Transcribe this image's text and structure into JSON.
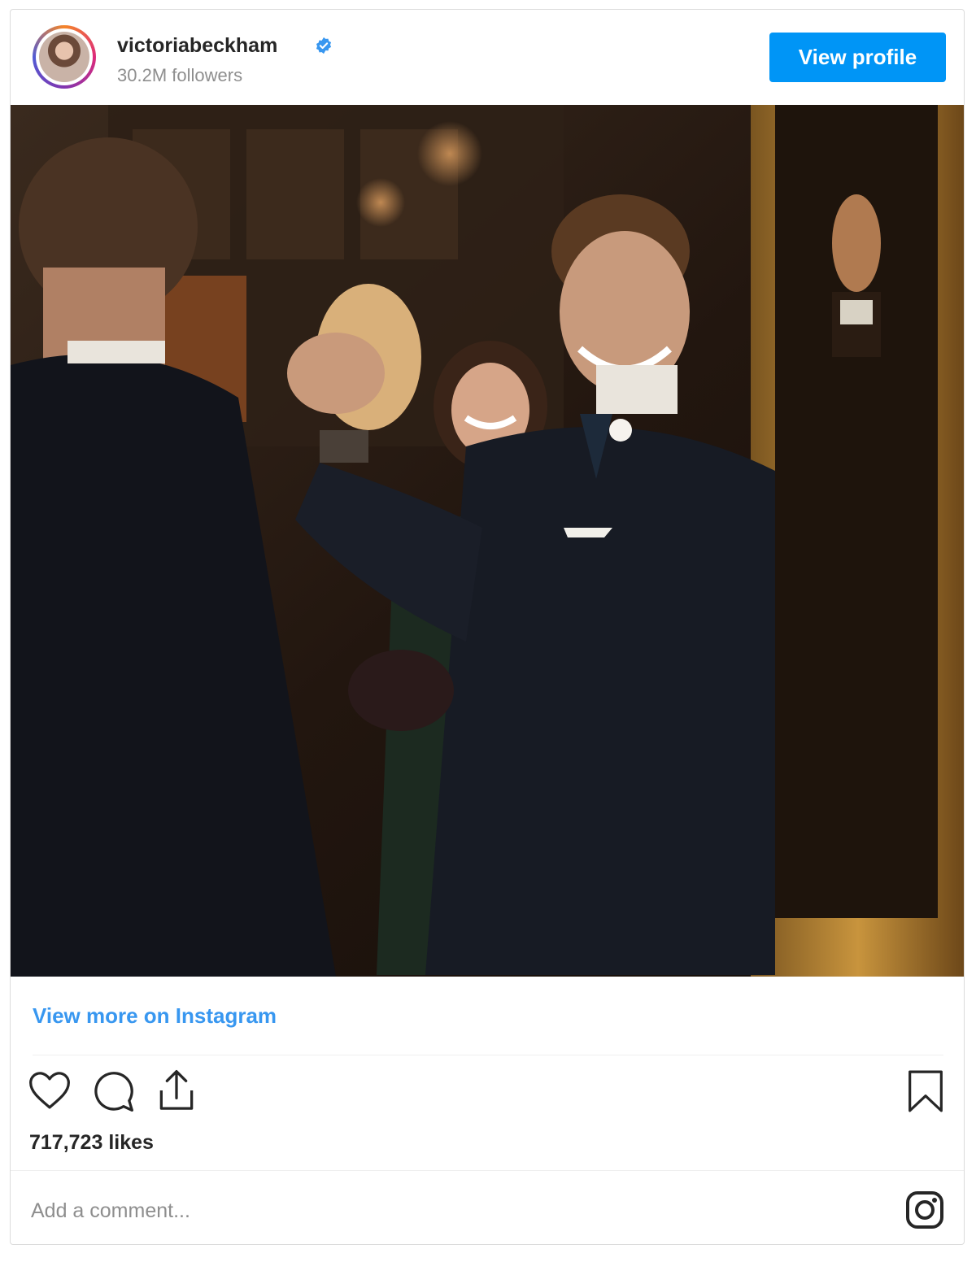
{
  "post": {
    "username": "victoriabeckham",
    "followers": "30.2M followers",
    "view_profile_label": "View profile",
    "view_more_label": "View more on Instagram",
    "likes": "717,723 likes",
    "comment_placeholder": "Add a comment..."
  },
  "colors": {
    "accent_blue": "#0095f6",
    "link_blue": "#3897f0",
    "verified_blue": "#3897f0",
    "text_dark": "#262626",
    "text_muted": "#8e8e8e"
  },
  "icons": [
    "verified-badge-icon",
    "heart-icon",
    "comment-icon",
    "share-icon",
    "bookmark-icon",
    "instagram-logo-icon"
  ]
}
